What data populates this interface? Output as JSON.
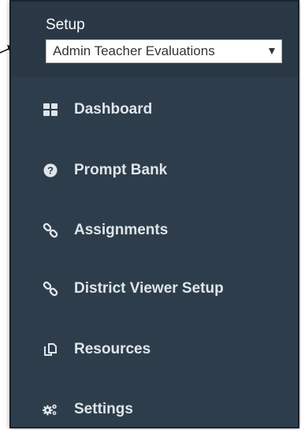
{
  "setup": {
    "label": "Setup",
    "select_value": "Admin Teacher Evaluations"
  },
  "menu": {
    "items": [
      {
        "label": "Dashboard",
        "icon": "dashboard-grid-icon"
      },
      {
        "label": "Prompt Bank",
        "icon": "question-circle-icon"
      },
      {
        "label": "Assignments",
        "icon": "link-icon"
      },
      {
        "label": "District Viewer Setup",
        "icon": "link-icon"
      },
      {
        "label": "Resources",
        "icon": "copy-icon"
      },
      {
        "label": "Settings",
        "icon": "gears-icon"
      }
    ]
  },
  "colors": {
    "sidebar_bg": "#2e3d4b",
    "header_bg": "#2a3845",
    "text": "#dfe5ea",
    "accent": "#ffffff"
  }
}
